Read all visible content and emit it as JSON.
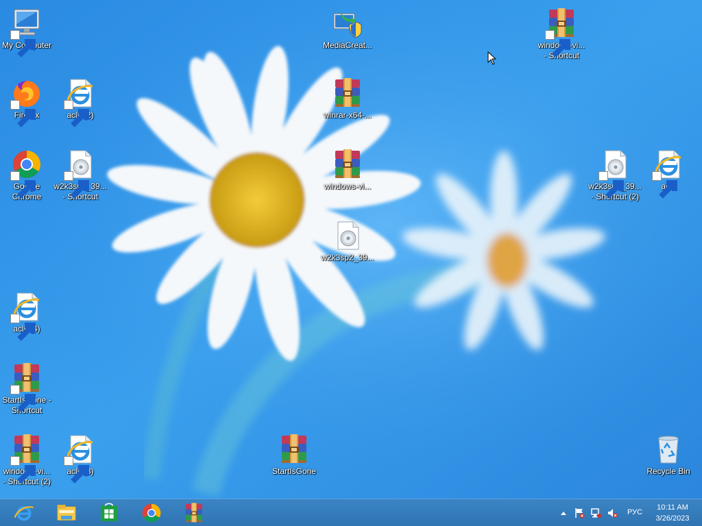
{
  "desktop_icons": {
    "my_computer": "My Computer",
    "firefox": "Firefox",
    "aclk2": "aclk (2)",
    "chrome": "Google\nChrome",
    "w2k3_shortcut": "w2k3sp2_39...\n- Shortcut",
    "aclk4": "aclk (4)",
    "startisgone_shortcut": "StartIsGone -\nShortcut",
    "windows_vi_shortcut2": "windows-vi...\n- Shortcut (2)",
    "aclk3": "aclk (3)",
    "mediacreat": "MediaCreat...",
    "winrar_x64": "winrar-x64-...",
    "windows_vi": "windows-vi...",
    "w2k3": "w2k3sp2_39...",
    "startisgone": "StartIsGone",
    "windows_vi_shortcut": "windows-vi...\n- Shortcut",
    "w2k3_shortcut2": "w2k3sp2_39...\n- Shortcut (2)",
    "aclk": "aclk",
    "recycle_bin": "Recycle Bin"
  },
  "taskbar": {
    "pinned": [
      "internet-explorer-icon",
      "file-explorer-icon",
      "store-icon",
      "chrome-icon",
      "winrar-icon"
    ],
    "tray": {
      "language": "РУС",
      "time": "10:11 AM",
      "date": "3/26/2023"
    }
  }
}
